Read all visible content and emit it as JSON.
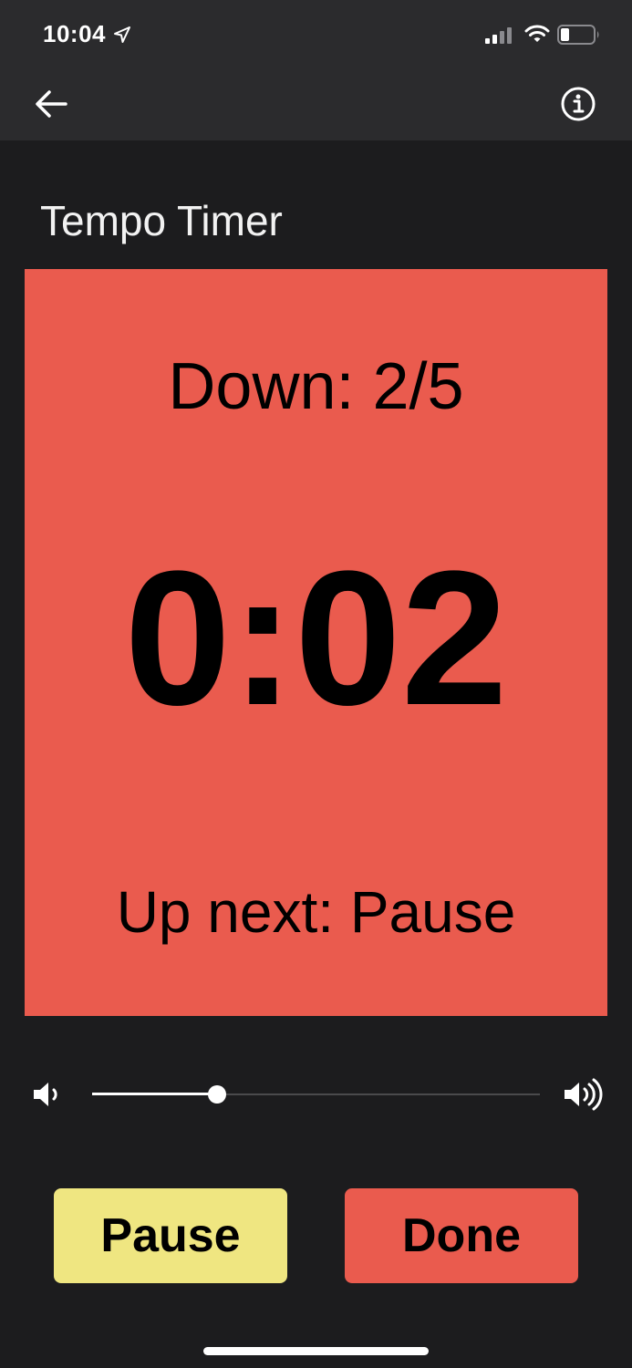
{
  "status_bar": {
    "time": "10:04",
    "icons": [
      "location-arrow-icon",
      "cellular-signal-icon",
      "wifi-icon",
      "battery-icon"
    ]
  },
  "nav": {
    "back_icon": "arrow-left-icon",
    "info_icon": "info-circle-icon"
  },
  "page": {
    "title": "Tempo Timer"
  },
  "timer": {
    "phase": "Down: 2/5",
    "countdown": "0:02",
    "up_next": "Up next: Pause",
    "card_color": "#ea5b4e"
  },
  "volume": {
    "level": 0.28,
    "low_icon": "volume-low-icon",
    "high_icon": "volume-high-icon"
  },
  "buttons": {
    "pause_label": "Pause",
    "done_label": "Done",
    "pause_color": "#efe681",
    "done_color": "#ea5b4e"
  },
  "colors": {
    "background": "#1c1c1e",
    "bar": "#2b2b2d"
  }
}
